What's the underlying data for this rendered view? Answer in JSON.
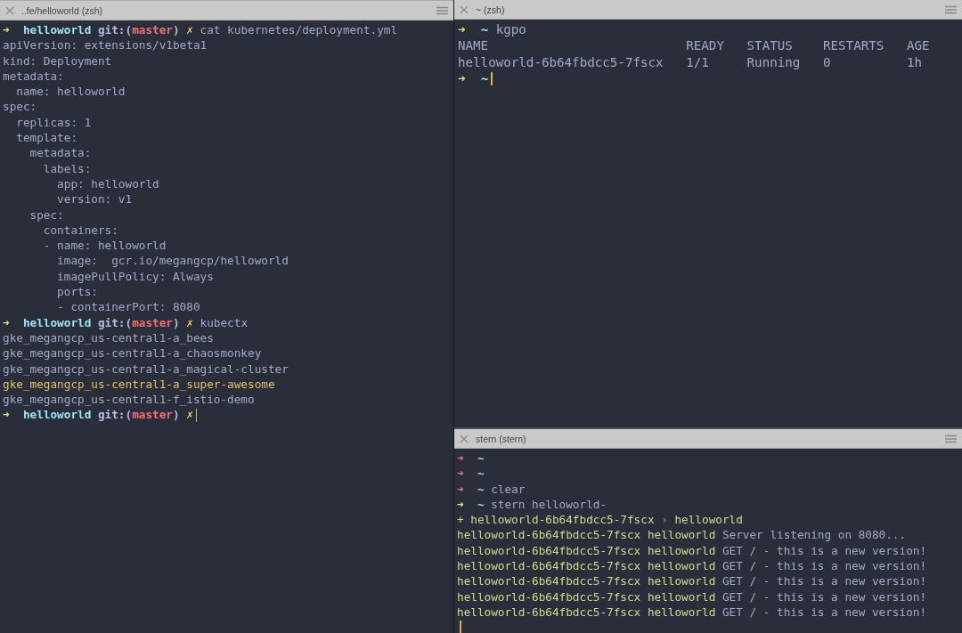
{
  "panes": [
    {
      "title": "..fe/helloworld (zsh)",
      "lines": [
        {
          "segments": [
            {
              "kind": "arrow-ok",
              "text": "➜  "
            },
            {
              "kind": "dir",
              "text": "helloworld "
            },
            {
              "kind": "git",
              "text": "git:("
            },
            {
              "kind": "branch",
              "text": "master"
            },
            {
              "kind": "git",
              "text": ") "
            },
            {
              "kind": "dirty",
              "text": "✗ "
            },
            {
              "kind": "plain",
              "text": "cat kubernetes/deployment.yml"
            }
          ]
        },
        {
          "segments": [
            {
              "kind": "plain",
              "text": "apiVersion: extensions/v1beta1"
            }
          ]
        },
        {
          "segments": [
            {
              "kind": "plain",
              "text": "kind: Deployment"
            }
          ]
        },
        {
          "segments": [
            {
              "kind": "plain",
              "text": "metadata:"
            }
          ]
        },
        {
          "segments": [
            {
              "kind": "plain",
              "text": "  name: helloworld"
            }
          ]
        },
        {
          "segments": [
            {
              "kind": "plain",
              "text": "spec:"
            }
          ]
        },
        {
          "segments": [
            {
              "kind": "plain",
              "text": "  replicas: 1"
            }
          ]
        },
        {
          "segments": [
            {
              "kind": "plain",
              "text": "  template:"
            }
          ]
        },
        {
          "segments": [
            {
              "kind": "plain",
              "text": "    metadata:"
            }
          ]
        },
        {
          "segments": [
            {
              "kind": "plain",
              "text": "      labels:"
            }
          ]
        },
        {
          "segments": [
            {
              "kind": "plain",
              "text": "        app: helloworld"
            }
          ]
        },
        {
          "segments": [
            {
              "kind": "plain",
              "text": "        version: v1"
            }
          ]
        },
        {
          "segments": [
            {
              "kind": "plain",
              "text": "    spec:"
            }
          ]
        },
        {
          "segments": [
            {
              "kind": "plain",
              "text": "      containers:"
            }
          ]
        },
        {
          "segments": [
            {
              "kind": "plain",
              "text": "      - name: helloworld"
            }
          ]
        },
        {
          "segments": [
            {
              "kind": "plain",
              "text": "        image:  gcr.io/megangcp/helloworld"
            }
          ]
        },
        {
          "segments": [
            {
              "kind": "plain",
              "text": "        imagePullPolicy: Always"
            }
          ]
        },
        {
          "segments": [
            {
              "kind": "plain",
              "text": "        ports:"
            }
          ]
        },
        {
          "segments": [
            {
              "kind": "plain",
              "text": "        - containerPort: 8080"
            }
          ]
        },
        {
          "segments": [
            {
              "kind": "arrow-ok",
              "text": "➜  "
            },
            {
              "kind": "dir",
              "text": "helloworld "
            },
            {
              "kind": "git",
              "text": "git:("
            },
            {
              "kind": "branch",
              "text": "master"
            },
            {
              "kind": "git",
              "text": ") "
            },
            {
              "kind": "dirty",
              "text": "✗ "
            },
            {
              "kind": "plain",
              "text": "kubectx"
            }
          ]
        },
        {
          "segments": [
            {
              "kind": "plain",
              "text": "gke_megangcp_us-central1-a_bees"
            }
          ]
        },
        {
          "segments": [
            {
              "kind": "plain",
              "text": "gke_megangcp_us-central1-a_chaosmonkey"
            }
          ]
        },
        {
          "segments": [
            {
              "kind": "plain",
              "text": "gke_megangcp_us-central1-a_magical-cluster"
            }
          ]
        },
        {
          "segments": [
            {
              "kind": "highlight",
              "text": "gke_megangcp_us-central1-a_super-awesome"
            }
          ]
        },
        {
          "segments": [
            {
              "kind": "plain",
              "text": "gke_megangcp_us-central1-f_istio-demo"
            }
          ]
        },
        {
          "segments": [
            {
              "kind": "arrow-ok",
              "text": "➜  "
            },
            {
              "kind": "dir",
              "text": "helloworld "
            },
            {
              "kind": "git",
              "text": "git:("
            },
            {
              "kind": "branch",
              "text": "master"
            },
            {
              "kind": "git",
              "text": ") "
            },
            {
              "kind": "dirty",
              "text": "✗"
            }
          ],
          "cursor": true
        }
      ]
    },
    {
      "title": "~ (zsh)",
      "lines": [
        {
          "segments": [
            {
              "kind": "arrow-ok",
              "text": "➜  "
            },
            {
              "kind": "dir",
              "text": "~ "
            },
            {
              "kind": "plain",
              "text": "kgpo"
            }
          ]
        },
        {
          "segments": [
            {
              "kind": "plain",
              "text": "NAME                          READY   STATUS    RESTARTS   AGE"
            }
          ]
        },
        {
          "segments": [
            {
              "kind": "plain",
              "text": "helloworld-6b64fbdcc5-7fscx   1/1     Running   0          1h"
            }
          ]
        },
        {
          "segments": [
            {
              "kind": "arrow-ok",
              "text": "➜  "
            },
            {
              "kind": "dir",
              "text": "~"
            }
          ],
          "cursor": true
        }
      ]
    },
    {
      "title": "stern (stern)",
      "lines": [
        {
          "segments": [
            {
              "kind": "arrow-error",
              "text": "➜  "
            },
            {
              "kind": "dir",
              "text": "~"
            }
          ]
        },
        {
          "segments": [
            {
              "kind": "arrow-error",
              "text": "➜  "
            },
            {
              "kind": "dir",
              "text": "~"
            }
          ]
        },
        {
          "segments": [
            {
              "kind": "arrow-error",
              "text": "➜  "
            },
            {
              "kind": "dir",
              "text": "~ "
            },
            {
              "kind": "plain",
              "text": "clear"
            }
          ]
        },
        {
          "segments": [
            {
              "kind": "arrow-ok",
              "text": "➜  "
            },
            {
              "kind": "dir",
              "text": "~ "
            },
            {
              "kind": "plain",
              "text": "stern helloworld-"
            }
          ]
        },
        {
          "segments": [
            {
              "kind": "pod",
              "text": "+ helloworld-6b64fbdcc5-7fscx "
            },
            {
              "kind": "dim",
              "text": "› "
            },
            {
              "kind": "pod",
              "text": "helloworld"
            }
          ]
        },
        {
          "segments": [
            {
              "kind": "pod",
              "text": "helloworld-6b64fbdcc5-7fscx helloworld "
            },
            {
              "kind": "plain",
              "text": "Server listening on 8080..."
            }
          ]
        },
        {
          "segments": [
            {
              "kind": "pod",
              "text": "helloworld-6b64fbdcc5-7fscx helloworld "
            },
            {
              "kind": "plain",
              "text": "GET / - this is a new version!"
            }
          ]
        },
        {
          "segments": [
            {
              "kind": "pod",
              "text": "helloworld-6b64fbdcc5-7fscx helloworld "
            },
            {
              "kind": "plain",
              "text": "GET / - this is a new version!"
            }
          ]
        },
        {
          "segments": [
            {
              "kind": "pod",
              "text": "helloworld-6b64fbdcc5-7fscx helloworld "
            },
            {
              "kind": "plain",
              "text": "GET / - this is a new version!"
            }
          ]
        },
        {
          "segments": [
            {
              "kind": "pod",
              "text": "helloworld-6b64fbdcc5-7fscx helloworld "
            },
            {
              "kind": "plain",
              "text": "GET / - this is a new version!"
            }
          ]
        },
        {
          "segments": [
            {
              "kind": "pod",
              "text": "helloworld-6b64fbdcc5-7fscx helloworld "
            },
            {
              "kind": "plain",
              "text": "GET / - this is a new version!"
            }
          ]
        },
        {
          "cursor": true
        }
      ]
    }
  ]
}
